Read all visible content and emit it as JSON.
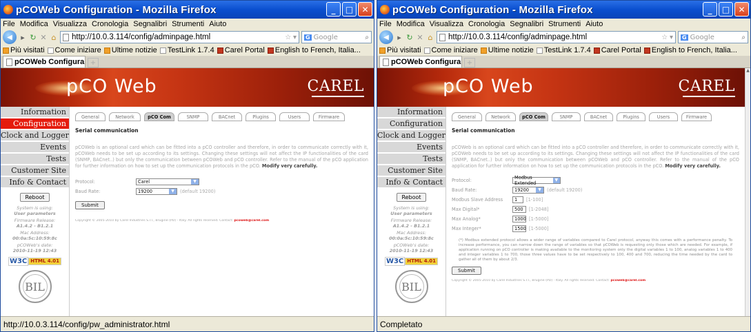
{
  "left": {
    "title": "pCOWeb Configuration - Mozilla Firefox",
    "menu": [
      "File",
      "Modifica",
      "Visualizza",
      "Cronologia",
      "Segnalibri",
      "Strumenti",
      "Aiuto"
    ],
    "url": "http://10.0.3.114/config/adminpage.html",
    "search_placeholder": "Google",
    "bookmarks": [
      "Più visitati",
      "Come iniziare",
      "Ultime notizie",
      "TestLink 1.7.4",
      "Carel Portal",
      "English to French, Italia..."
    ],
    "tab_title": "pCOWeb Configura...",
    "status": "http://10.0.3.114/config/pw_administrator.html",
    "logo": "pCO Web",
    "brand": "CAREL",
    "nav": [
      "Information",
      "Configuration",
      "Clock and Logger",
      "Events",
      "Tests",
      "Customer Site",
      "Info & Contact"
    ],
    "active_nav": "Configuration",
    "reboot": "Reboot",
    "sys_using_label": "System is using:",
    "sys_using_value": "User parameters",
    "fw_label": "Firmware Release:",
    "fw_value": "A1.4.2 - B1.2.1",
    "mac_label": "Mac Address:",
    "mac_value": "00:0a:5c:10:59:8c",
    "date_label": "pCOWeb's date:",
    "date_value": "2010-11-19 12:43",
    "w3c": "W3C",
    "html_badge": "HTML 4.01",
    "bil": "BIL",
    "tabs": [
      "General",
      "Network",
      "pCO Com",
      "SNMP",
      "BACnet",
      "Plugins",
      "Users",
      "Firmware"
    ],
    "active_tab": "pCO Com",
    "section_title": "Serial communication",
    "paragraph": "pCOWeb is an optional card which can be fitted into a pCO controller and therefore, in order to communicate correctly with it, pCOWeb needs to be set up according to its settings. Changing these settings will not affect the IP functionalities of the card (SNMP, BACnet..) but only the communication between pCOWeb and pCO controller. Refer to the manual of the pCO application for further information on how to set up the communication protocols in the pCO.",
    "paragraph_bold": "Modify very carefully.",
    "protocol_label": "Protocol:",
    "protocol_value": "Carel",
    "baud_label": "Baud Rate:",
    "baud_value": "19200",
    "baud_hint": "(default 19200)",
    "submit": "Submit",
    "copyright": "Copyright © 2005-2010 by Carel Industries S.r.l., Brugine (PD) - Italy. All rights reserved. Contact:",
    "contact_email": "pcoweb@carel.com"
  },
  "right": {
    "title": "pCOWeb Configuration - Mozilla Firefox",
    "menu": [
      "File",
      "Modifica",
      "Visualizza",
      "Cronologia",
      "Segnalibri",
      "Strumenti",
      "Aiuto"
    ],
    "url": "http://10.0.3.114/config/adminpage.html",
    "search_placeholder": "Google",
    "bookmarks": [
      "Più visitati",
      "Come iniziare",
      "Ultime notizie",
      "TestLink 1.7.4",
      "Carel Portal",
      "English to French, Italia..."
    ],
    "tab_title": "pCOWeb Configura...",
    "status": "Completato",
    "logo": "pCO Web",
    "brand": "CAREL",
    "nav": [
      "Information",
      "Configuration",
      "Clock and Logger",
      "Events",
      "Tests",
      "Customer Site",
      "Info & Contact"
    ],
    "reboot": "Reboot",
    "sys_using_label": "System is using:",
    "sys_using_value": "User parameters",
    "fw_label": "Firmware Release:",
    "fw_value": "A1.4.2 - B1.2.1",
    "mac_label": "Mac Address:",
    "mac_value": "00:0a:5c:10:59:8c",
    "date_label": "pCOWeb's date:",
    "date_value": "2010-11-19 12:43",
    "w3c": "W3C",
    "html_badge": "HTML 4.01",
    "bil": "BIL",
    "tabs": [
      "General",
      "Network",
      "pCO Com",
      "SNMP",
      "BACnet",
      "Plugins",
      "Users",
      "Firmware"
    ],
    "active_tab": "pCO Com",
    "section_title": "Serial communication",
    "paragraph": "pCOWeb is an optional card which can be fitted into a pCO controller and therefore, in order to communicate correctly with it, pCOWeb needs to be set up according to its settings. Changing these settings will not affect the IP functionalities of the card (SNMP, BACnet..) but only the communication between pCOWeb and pCO controller. Refer to the manual of the pCO application for further information on how to set up the communication protocols in the pCO.",
    "paragraph_bold": "Modify very carefully.",
    "protocol_label": "Protocol:",
    "protocol_value": "Modbus Extended",
    "baud_label": "Baud Rate:",
    "baud_value": "19200",
    "baud_hint": "(default 19200)",
    "slave_label": "Modbus Slave Address",
    "slave_value": "1",
    "slave_hint": "[1-100]",
    "digital_label": "Max Digital*",
    "digital_value": "500",
    "digital_hint": "[1-2048]",
    "analog_label": "Max Analog*",
    "analog_value": "1000",
    "analog_hint": "[1-5000]",
    "integer_label": "Max Integer*",
    "integer_value": "1500",
    "integer_hint": "[1-5000]",
    "note": "(*) Modbus extended protocol allows a wider range of variables compared to Carel protocol, anyway this comes with a performance penalty. To increase performance, you can narrow down the range of variables so that pCOWeb is requesting only those which are needed. For example, if application running on pCO controller is making available to the monitoring system only the digital variables 1 to 100, analog variables 1 to 400 and integer variables 1 to 700, those three values have to be set respectively to 100, 400 and 700, reducing the time needed by the card to gather all of them by about 2/3.",
    "submit": "Submit",
    "copyright": "Copyright © 2005-2010 by Carel Industries S.r.l., Brugine (PD) - Italy. All rights reserved. Contact:",
    "contact_email": "pcoweb@carel.com"
  }
}
